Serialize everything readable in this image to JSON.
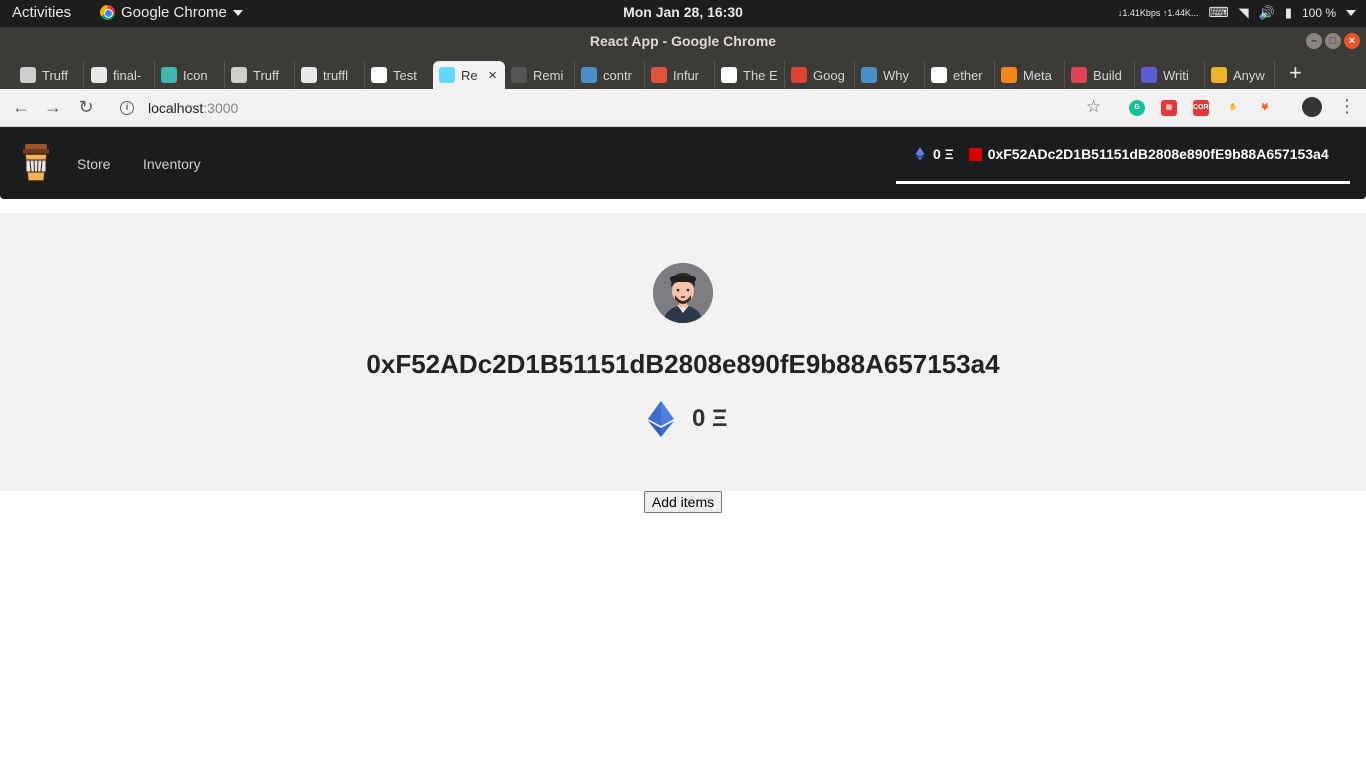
{
  "system": {
    "activities": "Activities",
    "app_name": "Google Chrome",
    "clock": "Mon Jan 28, 16:30",
    "net_speed": "↓1.41Kbps ↑1.44K...",
    "battery": "100 %"
  },
  "window": {
    "title": "React App - Google Chrome"
  },
  "tabs": [
    {
      "label": "Truff",
      "favicon": "truffle-icon",
      "color": "#cfcfcf"
    },
    {
      "label": "final-",
      "favicon": "github-icon",
      "color": "#e8e8e8"
    },
    {
      "label": "Icon",
      "favicon": "react-icon",
      "color": "#3fb9b0"
    },
    {
      "label": "Truff",
      "favicon": "truffle-icon",
      "color": "#cfcfcf"
    },
    {
      "label": "truffl",
      "favicon": "github-icon",
      "color": "#e8e8e8"
    },
    {
      "label": "Test",
      "favicon": "medium-icon",
      "color": "#ffffff"
    },
    {
      "label": "Re",
      "favicon": "react-icon",
      "color": "#61dafb"
    },
    {
      "label": "Remi",
      "favicon": "ethereum-icon",
      "color": "#555555"
    },
    {
      "label": "contr",
      "favicon": "ethereum-se-icon",
      "color": "#4a90c8"
    },
    {
      "label": "Infur",
      "favicon": "infura-icon",
      "color": "#e0533f"
    },
    {
      "label": "The E",
      "favicon": "medium-icon",
      "color": "#ffffff"
    },
    {
      "label": "Goog",
      "favicon": "google-plus-icon",
      "color": "#db4437"
    },
    {
      "label": "Why",
      "favicon": "ethereum-se-icon",
      "color": "#4a90c8"
    },
    {
      "label": "ether",
      "favicon": "google-icon",
      "color": "#ffffff"
    },
    {
      "label": "Meta",
      "favicon": "metamask-icon",
      "color": "#f6851b"
    },
    {
      "label": "Build",
      "favicon": "openzeppelin-icon",
      "color": "#e04357"
    },
    {
      "label": "Writi",
      "favicon": "openjs-icon",
      "color": "#5b5bd6"
    },
    {
      "label": "Anyw",
      "favicon": "w-icon",
      "color": "#f0b429"
    }
  ],
  "toolbar": {
    "url_host": "localhost",
    "url_port": ":3000"
  },
  "extensions": [
    {
      "name": "grammarly-icon",
      "color": "#15c39a",
      "glyph": "G"
    },
    {
      "name": "ext-red-icon",
      "color": "#e53935",
      "glyph": "▦"
    },
    {
      "name": "cors-icon",
      "color": "#e53935",
      "glyph": "CORS"
    },
    {
      "name": "paw-icon",
      "color": "#222222",
      "glyph": "✋"
    },
    {
      "name": "metamask-icon",
      "color": "#f6851b",
      "glyph": "🦊"
    }
  ],
  "appnav": {
    "links": [
      "Store",
      "Inventory"
    ],
    "balance": "0 Ξ",
    "address": "0xF52ADc2D1B51151dB2808e890fE9b88A657153a4"
  },
  "profile": {
    "address": "0xF52ADc2D1B51151dB2808e890fE9b88A657153a4",
    "balance": "0 Ξ"
  },
  "actions": {
    "add_items": "Add items"
  },
  "colors": {
    "navbar": "#1b1c1d",
    "profile_bg": "#f2f2f2",
    "eth_blue": "#3c6fd3",
    "wallet_marker": "#db0000"
  }
}
